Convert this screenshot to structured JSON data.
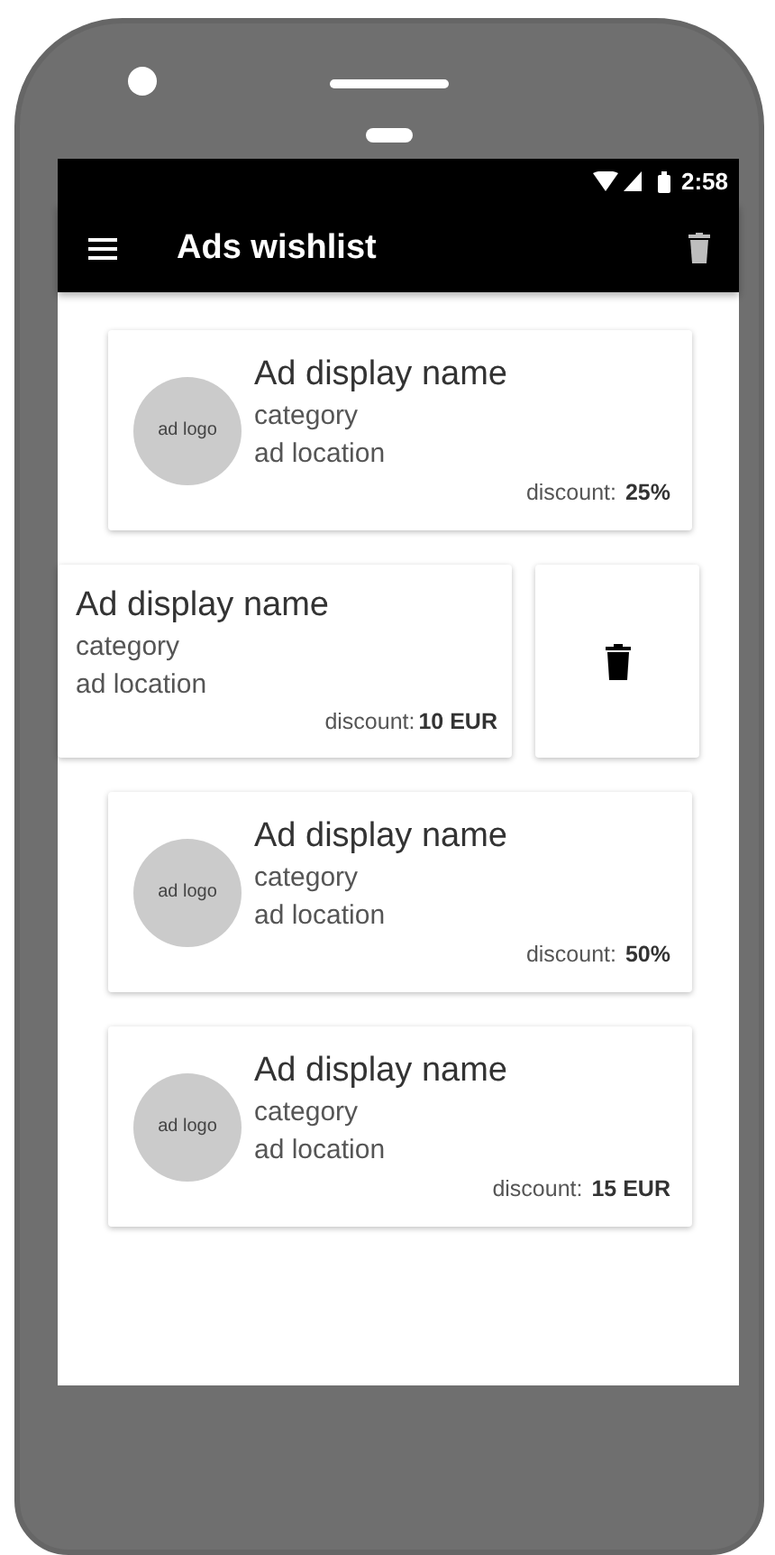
{
  "status_bar": {
    "time": "2:58"
  },
  "app_bar": {
    "title": "Ads wishlist"
  },
  "ads": [
    {
      "kind": "normal",
      "logo": "ad logo",
      "name": "Ad display name",
      "category": "category",
      "location": "ad location",
      "discount_label": "discount:",
      "discount": "25%"
    },
    {
      "kind": "swiped",
      "name": "Ad display name",
      "category": "category",
      "location": "ad location",
      "discount_label": "discount:",
      "discount": "10 EUR"
    },
    {
      "kind": "normal",
      "logo": "ad logo",
      "name": "Ad display name",
      "category": "category",
      "location": "ad location",
      "discount_label": "discount:",
      "discount": "50%"
    },
    {
      "kind": "normal",
      "logo": "ad logo",
      "name": "Ad display name",
      "category": "category",
      "location": "ad location",
      "discount_label": "discount:",
      "discount": "15 EUR"
    }
  ]
}
